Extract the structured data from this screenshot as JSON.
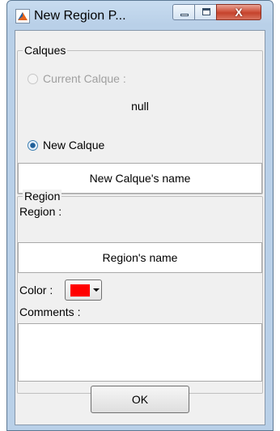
{
  "window": {
    "title": "New Region P...",
    "close_glyph": "X"
  },
  "calques": {
    "group_title": "Calques",
    "current_label": "Current Calque :",
    "current_value": "null",
    "new_label": "New Calque",
    "new_name_value": "New Calque's name"
  },
  "region": {
    "group_title": "Region",
    "region_label": "Region :",
    "region_name_value": "Region's name",
    "color_label": "Color :",
    "color_value": "#ff0000",
    "comments_label": "Comments :",
    "comments_value": ""
  },
  "ok_label": "OK"
}
